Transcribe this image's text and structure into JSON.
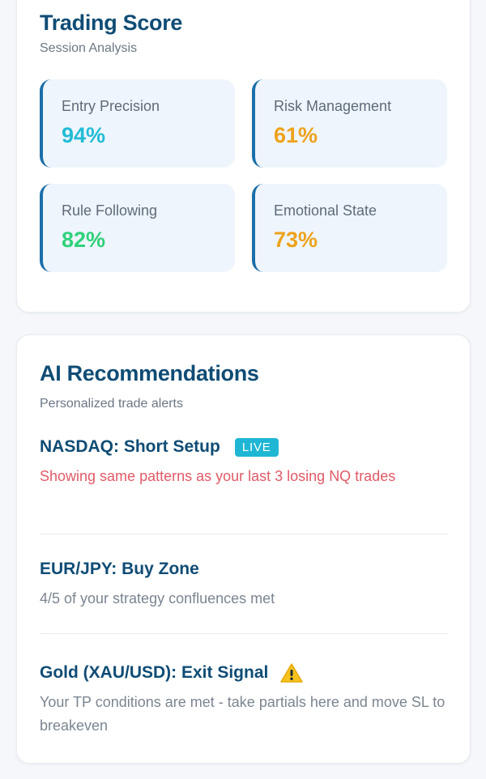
{
  "trading_score": {
    "title": "Trading Score",
    "subtitle": "Session Analysis",
    "metrics": [
      {
        "label": "Entry Precision",
        "value": "94%",
        "color": "#22bcd6"
      },
      {
        "label": "Risk Management",
        "value": "61%",
        "color": "#eea21b"
      },
      {
        "label": "Rule Following",
        "value": "82%",
        "color": "#2fd17a"
      },
      {
        "label": "Emotional State",
        "value": "73%",
        "color": "#eea21b"
      }
    ],
    "accent_color": "#1b6fa8"
  },
  "ai_recommendations": {
    "title": "AI Recommendations",
    "subtitle": "Personalized trade alerts",
    "items": [
      {
        "title": "NASDAQ: Short Setup",
        "badge": "LIVE",
        "text": "Showing same patterns as your last 3 losing NQ trades",
        "text_color": "#e05a66"
      },
      {
        "title": "EUR/JPY: Buy Zone",
        "text": "4/5 of your strategy confluences met",
        "text_color": "#7b8590"
      },
      {
        "title": "Gold (XAU/USD): Exit Signal",
        "icon": "warning-icon",
        "text": "Your TP conditions are met - take partials here and move SL to breakeven",
        "text_color": "#7b8590"
      }
    ]
  }
}
